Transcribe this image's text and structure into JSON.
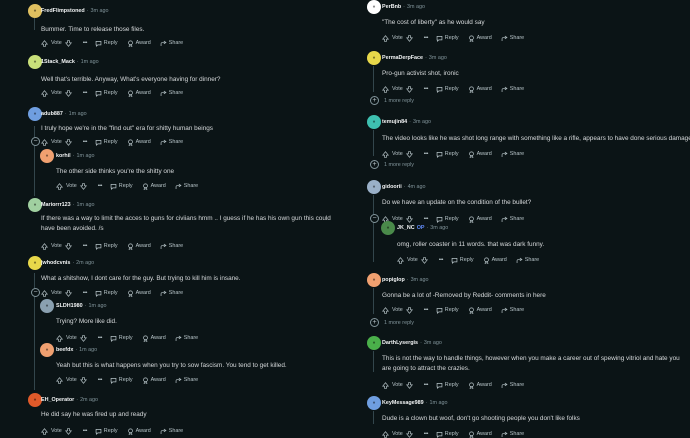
{
  "labels": {
    "vote": "Vote",
    "reply": "Reply",
    "award": "Award",
    "share": "Share",
    "more": "•••",
    "more_replies": "1 more reply",
    "op": "OP"
  },
  "left": [
    {
      "author": "FredFlimpstoned",
      "age": "3m ago",
      "text": "Bummer. Time to release those files.",
      "avatar_color": "#e0c060"
    },
    {
      "author": "1Stack_Mack",
      "age": "1m ago",
      "text": "Well that's terrible. Anyway, What's everyone having for dinner?",
      "avatar_color": "#c9e07a"
    },
    {
      "author": "adub887",
      "age": "1m ago",
      "text": "I truly hope we're in the \"find out\" era for shitty human beings",
      "avatar_color": "#6f9ee0"
    },
    {
      "author": "korhil",
      "age": "1m ago",
      "text": "The other side thinks you're the shitty one",
      "avatar_color": "#f0a070"
    },
    {
      "author": "Mariorrr123",
      "age": "1m ago",
      "text": "If there was a way to limit the acces to guns for civiians hmm .. I guess if he has his own gun this could have been avoided. /s",
      "avatar_color": "#a0d0a0"
    },
    {
      "author": "jwhodcvnis",
      "age": "2m ago",
      "text": "What a shitshow, I dont care for the guy. But trying to kill him is insane.",
      "avatar_color": "#e8d84a"
    },
    {
      "author": "SLDH1980",
      "age": "1m ago",
      "text": "Trying? More like did.",
      "avatar_color": "#8aa0b0"
    },
    {
      "author": "beefdx",
      "age": "1m ago",
      "text": "Yeah but this is what happens when you try to sow fascism. You tend to get killed.",
      "avatar_color": "#f0a070"
    },
    {
      "author": "EH_Operator",
      "age": "2m ago",
      "text": "He did say he was fired up and ready",
      "avatar_color": "#e05a2a"
    }
  ],
  "right": [
    {
      "author": "PerBnb",
      "age": "3m ago",
      "text": "\"The cost of liberty\" as he would say",
      "avatar_color": "#ffffff"
    },
    {
      "author": "PermaDerpFace",
      "age": "3m ago",
      "text": "Pro-gun activist shot, ironic",
      "avatar_color": "#e8d84a"
    },
    {
      "author": "temujin84",
      "age": "3m ago",
      "text": "The video looks like he was shot long range with something like a rifle, appears to have done serious damage.",
      "avatar_color": "#3ec0b0"
    },
    {
      "author": "gidoorii",
      "age": "4m ago",
      "text": "Do we have an update on the condition of the bullet?",
      "avatar_color": "#9ab0c8"
    },
    {
      "author": "JK_NC",
      "age": "3m ago",
      "text": "omg, roller coaster in 11 words. that was dark funny.",
      "avatar_color": "#4a8a4a",
      "is_op": true
    },
    {
      "author": "popiglop",
      "age": "3m ago",
      "text": "Gonna be a lot of -Removed by Reddit- comments in here",
      "avatar_color": "#f0a070"
    },
    {
      "author": "DarthLysergis",
      "age": "3m ago",
      "text": "This is not the way to handle things, however when you make a career out of spewing vitriol and hate you are going to attract the crazies.",
      "avatar_color": "#4ab04a"
    },
    {
      "author": "KeyMessage989",
      "age": "1m ago",
      "text": "Dude is a clown but woof, don't go shooting people you don't like folks",
      "avatar_color": "#6f9ee0"
    }
  ]
}
